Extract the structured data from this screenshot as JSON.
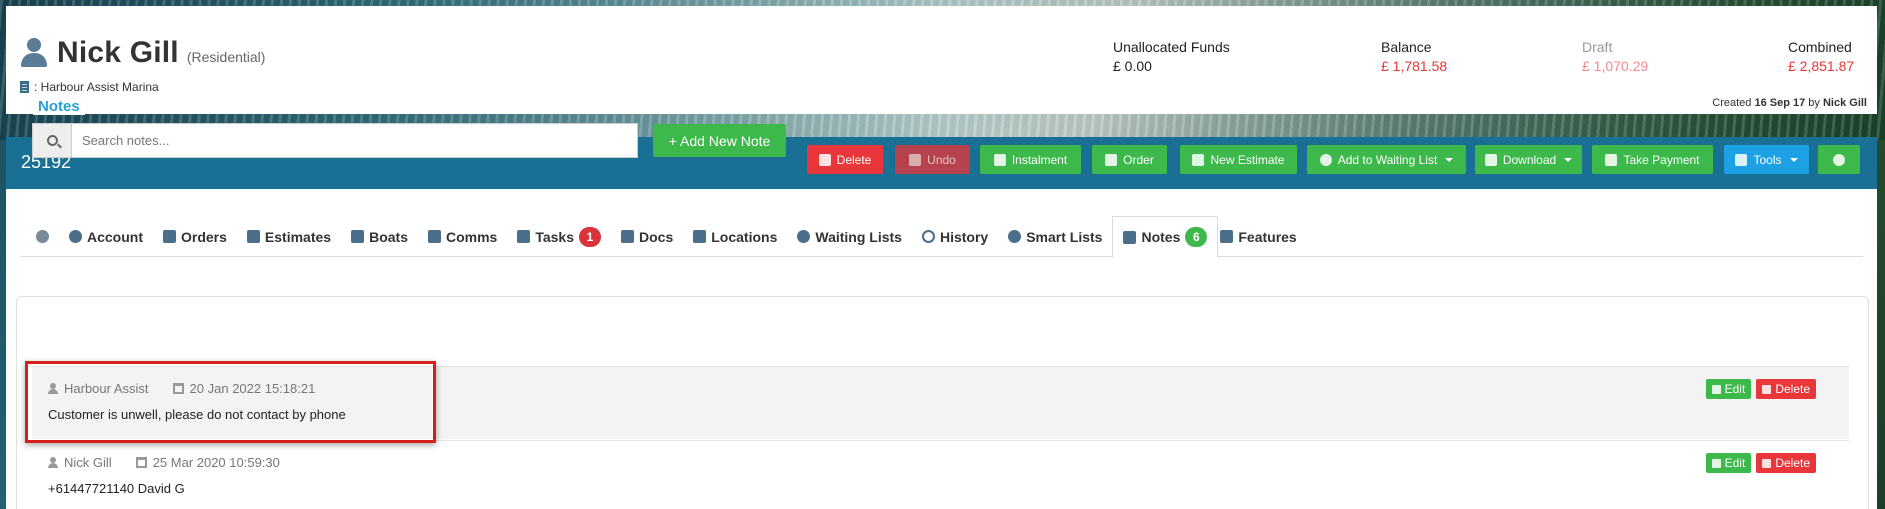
{
  "customer": {
    "name": "Nick Gill",
    "type": "(Residential)",
    "location": ": Harbour Assist Marina"
  },
  "finance": {
    "unallocated": {
      "label": "Unallocated Funds",
      "value": "£ 0.00",
      "color": "#222222"
    },
    "balance": {
      "label": "Balance",
      "value": "£ 1,781.58",
      "color": "#e8363a"
    },
    "draft": {
      "label": "Draft",
      "value": "£ 1,070.29",
      "color": "#f08a8e"
    },
    "combined": {
      "label": "Combined",
      "value": "£ 2,851.87",
      "color": "#e8363a"
    }
  },
  "created": {
    "prefix": "Created",
    "date": "16 Sep 17",
    "by": "by",
    "user": "Nick Gill"
  },
  "action_bar": {
    "ref": "25192",
    "buttons": {
      "delete": "Delete",
      "undo": "Undo",
      "instalment": "Instalment",
      "order": "Order",
      "new_estimate": "New Estimate",
      "waiting_list": "Add to Waiting List",
      "download": "Download",
      "take_payment": "Take Payment",
      "tools": "Tools"
    }
  },
  "tabs": {
    "account": "Account",
    "orders": "Orders",
    "estimates": "Estimates",
    "boats": "Boats",
    "comms": "Comms",
    "tasks": "Tasks",
    "tasks_count": "1",
    "docs": "Docs",
    "locations": "Locations",
    "waiting_lists": "Waiting Lists",
    "history": "History",
    "smart_lists": "Smart Lists",
    "notes": "Notes",
    "notes_count": "6",
    "features": "Features"
  },
  "notes": {
    "legend": "Notes",
    "search_placeholder": "Search notes...",
    "add_button": "+ Add New Note",
    "items": [
      {
        "author": "Harbour Assist",
        "date": "20 Jan 2022 15:18:21",
        "text": "Customer is unwell, please do not contact by phone",
        "edit": "Edit",
        "delete": "Delete"
      },
      {
        "author": "Nick Gill",
        "date": "25 Mar 2020 10:59:30",
        "text": "+61447721140 David G",
        "edit": "Edit",
        "delete": "Delete"
      }
    ]
  }
}
